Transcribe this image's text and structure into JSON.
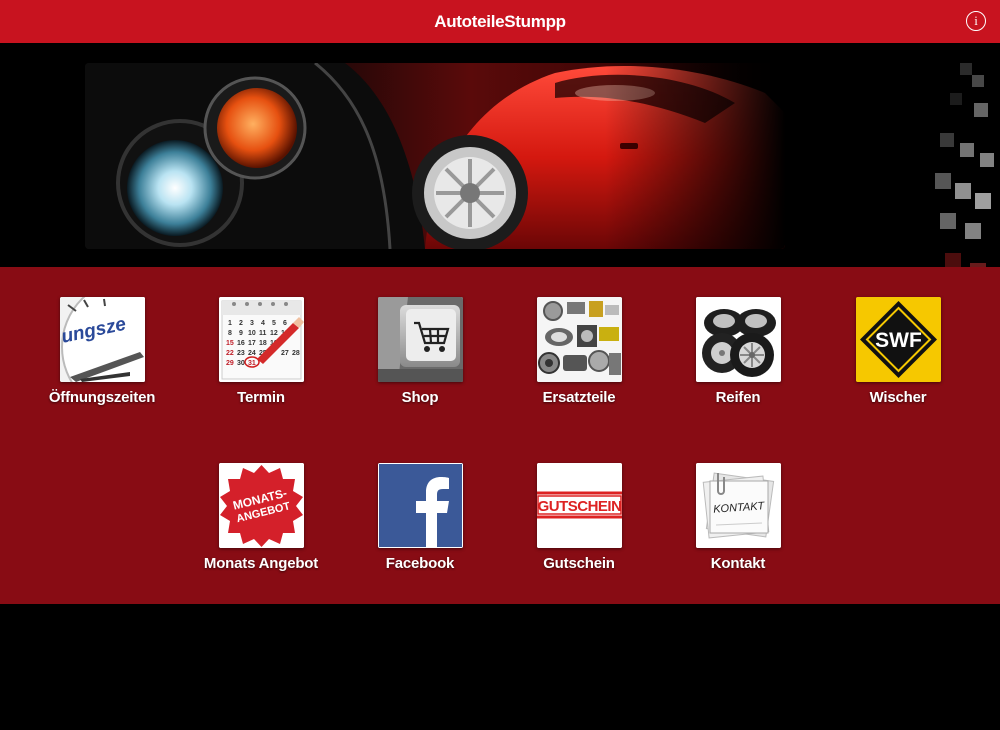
{
  "header": {
    "title": "AutoteileStumpp",
    "info_icon": "info-icon"
  },
  "colors": {
    "header_bg": "#c8131f",
    "menu_bg": "#880c14",
    "page_bg": "#000000"
  },
  "tiles": [
    {
      "label": "Öffnungszeiten",
      "icon": "clock-icon",
      "icon_text": "ungsze"
    },
    {
      "label": "Termin",
      "icon": "calendar-icon"
    },
    {
      "label": "Shop",
      "icon": "shopping-cart-icon"
    },
    {
      "label": "Ersatzteile",
      "icon": "car-parts-icon"
    },
    {
      "label": "Reifen",
      "icon": "tires-icon"
    },
    {
      "label": "Wischer",
      "icon": "swf-logo-icon",
      "icon_text": "SWF"
    },
    {
      "label": "Monats Angebot",
      "icon": "offer-badge-icon",
      "icon_text": "MONATS-ANGEBOT"
    },
    {
      "label": "Facebook",
      "icon": "facebook-icon"
    },
    {
      "label": "Gutschein",
      "icon": "voucher-stamp-icon",
      "icon_text": "GUTSCHEIN"
    },
    {
      "label": "Kontakt",
      "icon": "contact-notes-icon",
      "icon_text": "KONTAKT"
    }
  ]
}
